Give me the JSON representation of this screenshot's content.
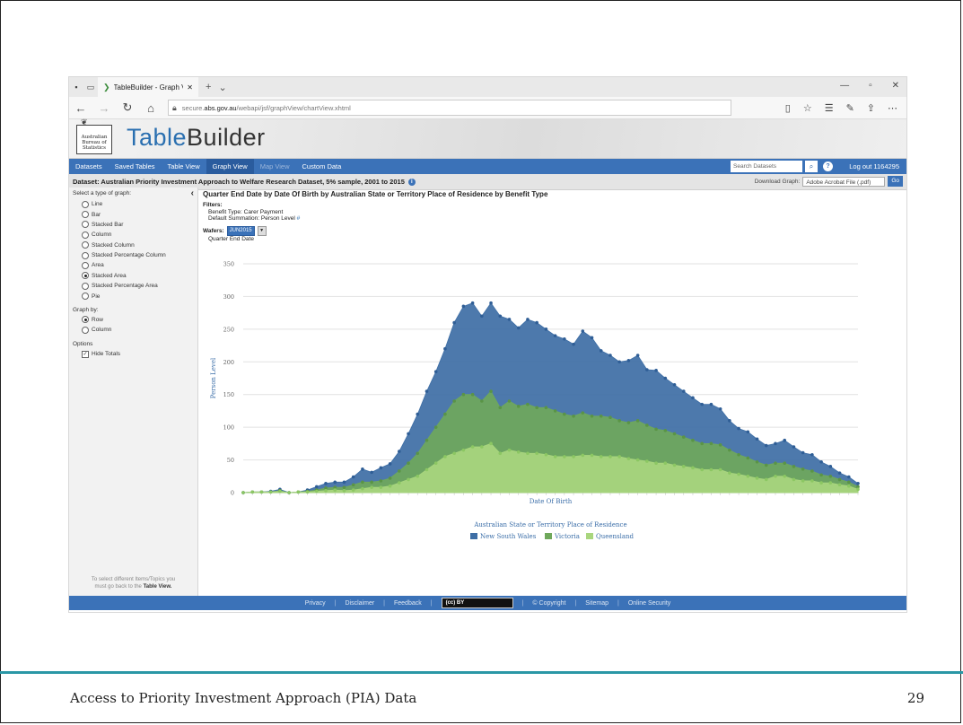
{
  "slide": {
    "footer_title": "Access to Priority Investment Approach (PIA) Data",
    "page_number": "29"
  },
  "browser": {
    "tab_title": "TableBuilder - Graph Vie",
    "url_prefix": "secure.",
    "url_domain": "abs.gov.au",
    "url_path": "/webapi/jsf/graphView/chartView.xhtml"
  },
  "header": {
    "logo_line1": "Australian",
    "logo_line2": "Bureau of",
    "logo_line3": "Statistics",
    "app_title_a": "Table",
    "app_title_b": "Builder"
  },
  "menu": {
    "items": [
      "Datasets",
      "Saved Tables",
      "Table View",
      "Graph View",
      "Map View",
      "Custom Data"
    ],
    "search_placeholder": "Search Datasets",
    "logout": "Log out 1164295"
  },
  "dataset": {
    "title": "Dataset: Australian Priority Investment Approach to Welfare Research Dataset, 5% sample, 2001 to 2015",
    "download_label": "Download Graph:",
    "download_value": "Adobe Acrobat File (.pdf)",
    "go": "Go"
  },
  "left_panel": {
    "graph_type_label": "Select a type of graph:",
    "collapse": "‹",
    "graph_types": [
      "Line",
      "Bar",
      "Stacked Bar",
      "Column",
      "Stacked Column",
      "Stacked Percentage Column",
      "Area",
      "Stacked Area",
      "Stacked Percentage Area",
      "Pie"
    ],
    "selected_graph_type": "Stacked Area",
    "graph_by_label": "Graph by:",
    "graph_by": [
      "Row",
      "Column"
    ],
    "selected_graph_by": "Row",
    "options_label": "Options",
    "hide_totals": "Hide Totals",
    "note_line1": "To select different Items/Topics you",
    "note_line2": "must go back to the",
    "note_link": "Table View."
  },
  "main": {
    "chart_title": "Quarter End Date by Date Of Birth by Australian State or Territory Place of Residence by Benefit Type",
    "filters_label": "Filters:",
    "filter_benefit": "Benefit Type: Carer Payment",
    "filter_summation": "Default Summation: Person Level",
    "filter_hash": "#",
    "wafers_label": "Wafers:",
    "wafers_value": "JUN2015",
    "wafers_sub": "Quarter End Date"
  },
  "colors": {
    "nsw": "#3e6ea5",
    "vic": "#6fa85b",
    "qld": "#a9d67e",
    "menubar": "#3b72b8"
  },
  "chart_data": {
    "type": "area",
    "stacked": true,
    "xlabel": "Date Of Birth",
    "ylabel": "Person Level",
    "ylim": [
      0,
      350
    ],
    "yticks": [
      0,
      50,
      100,
      150,
      200,
      250,
      300,
      350
    ],
    "legend_title": "Australian State or Territory Place of Residence",
    "legend_position": "bottom",
    "grid": true,
    "series": [
      {
        "name": "New South Wales",
        "color": "#3e6ea5",
        "values": [
          0,
          0,
          0,
          1,
          2,
          0,
          0,
          2,
          5,
          7,
          8,
          8,
          12,
          20,
          15,
          20,
          22,
          30,
          45,
          60,
          75,
          85,
          100,
          120,
          135,
          140,
          130,
          135,
          140,
          125,
          120,
          130,
          130,
          120,
          115,
          115,
          110,
          125,
          120,
          100,
          95,
          90,
          95,
          100,
          85,
          90,
          80,
          75,
          70,
          65,
          60,
          60,
          55,
          45,
          40,
          40,
          35,
          30,
          30,
          35,
          30,
          25,
          25,
          20,
          15,
          10,
          8,
          5
        ]
      },
      {
        "name": "Victoria",
        "color": "#6fa85b",
        "values": [
          0,
          0,
          0,
          0,
          1,
          0,
          0,
          1,
          2,
          4,
          4,
          5,
          8,
          10,
          8,
          10,
          12,
          18,
          25,
          35,
          45,
          55,
          65,
          80,
          85,
          80,
          70,
          80,
          70,
          75,
          70,
          75,
          70,
          72,
          70,
          65,
          62,
          65,
          60,
          62,
          60,
          55,
          55,
          60,
          55,
          52,
          50,
          48,
          45,
          42,
          40,
          40,
          38,
          35,
          30,
          28,
          25,
          22,
          20,
          20,
          20,
          18,
          15,
          12,
          10,
          8,
          6,
          4
        ]
      },
      {
        "name": "Queensland",
        "color": "#a9d67e",
        "values": [
          0,
          1,
          1,
          1,
          2,
          0,
          1,
          1,
          2,
          3,
          4,
          3,
          4,
          6,
          8,
          8,
          10,
          15,
          20,
          25,
          35,
          45,
          55,
          60,
          65,
          70,
          70,
          75,
          60,
          65,
          62,
          60,
          60,
          58,
          55,
          55,
          55,
          57,
          57,
          55,
          55,
          55,
          52,
          50,
          48,
          45,
          45,
          42,
          40,
          38,
          35,
          35,
          35,
          30,
          28,
          25,
          22,
          20,
          25,
          25,
          20,
          18,
          18,
          15,
          15,
          12,
          10,
          5
        ]
      }
    ],
    "x_count": 68
  }
}
